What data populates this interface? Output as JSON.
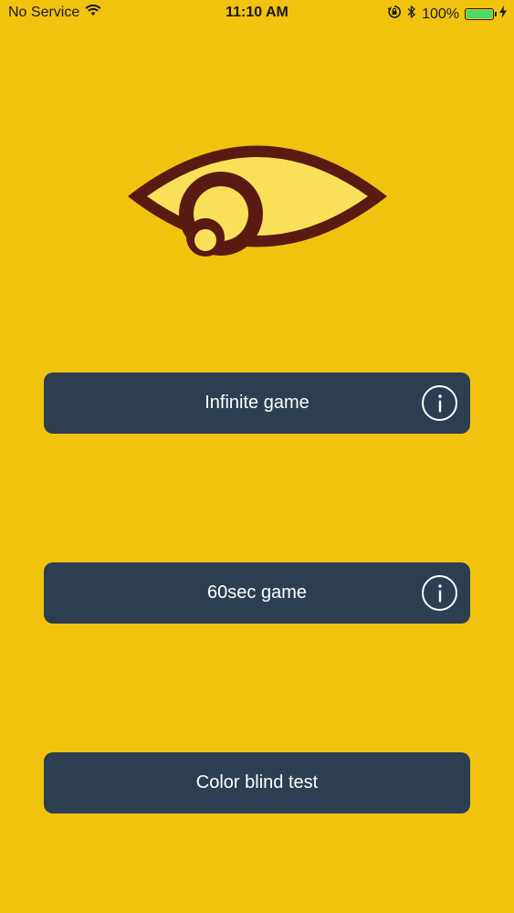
{
  "status_bar": {
    "carrier": "No Service",
    "time": "11:10 AM",
    "battery_percent": "100%",
    "battery_level": 1.0,
    "icons": [
      "wifi-icon",
      "orientation-lock-icon",
      "bluetooth-icon",
      "battery-icon",
      "charging-bolt-icon"
    ]
  },
  "logo": {
    "icon": "eye-logo-icon",
    "colors": {
      "outline": "#5A1A12",
      "fill": "#FAE05A"
    }
  },
  "menu": {
    "buttons": [
      {
        "label": "Infinite game",
        "info_icon": "info-icon"
      },
      {
        "label": "60sec game",
        "info_icon": "info-icon"
      },
      {
        "label": "Color blind test"
      }
    ]
  },
  "colors": {
    "background": "#F1C30E",
    "button": "#2C3E50",
    "button_text": "#FFFFFF",
    "battery_fill": "#4CD964"
  }
}
